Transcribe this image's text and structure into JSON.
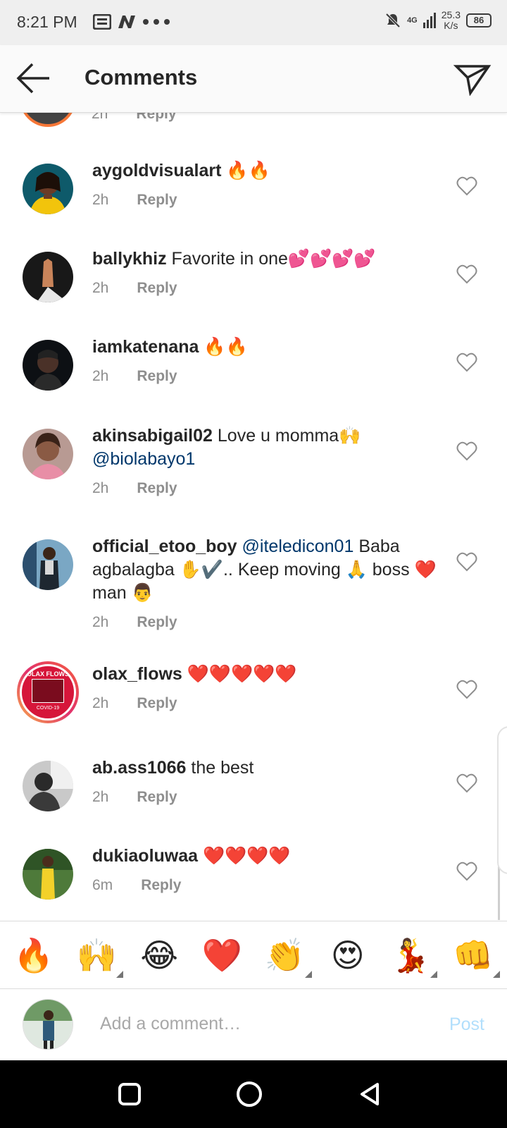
{
  "status_bar": {
    "time": "8:21 PM",
    "net_speed_value": "25.3",
    "net_speed_unit": "K/s",
    "battery": "86",
    "network": "4G"
  },
  "header": {
    "title": "Comments",
    "back_icon": "arrow-left-icon",
    "dm_icon": "paper-plane-icon"
  },
  "partial_comment": {
    "time": "2h",
    "reply": "Reply"
  },
  "comments": [
    {
      "username": "aygoldvisualart",
      "text": " 🔥🔥",
      "mention": "",
      "time": "2h",
      "reply": "Reply"
    },
    {
      "username": "ballykhiz",
      "text": " Favorite in one💕💕💕💕",
      "mention": "",
      "time": "2h",
      "reply": "Reply"
    },
    {
      "username": "iamkatenana",
      "text": " 🔥🔥",
      "mention": "",
      "time": "2h",
      "reply": "Reply"
    },
    {
      "username": "akinsabigail02",
      "text": " Love u momma🙌",
      "mention": "@biolabayo1",
      "time": "2h",
      "reply": "Reply"
    },
    {
      "username": "official_etoo_boy",
      "mention": "@iteledicon01",
      "text": " Baba agbalagba ✋✔️.. Keep moving 🙏 boss ❤️ man 👨",
      "time": "2h",
      "reply": "Reply"
    },
    {
      "username": "olax_flows",
      "text": " ❤️❤️❤️❤️❤️",
      "mention": "",
      "time": "2h",
      "reply": "Reply",
      "avatar_text": "OLAX FLOWS",
      "avatar_sub": "COVID-19"
    },
    {
      "username": "ab.ass1066",
      "text": " the best",
      "mention": "",
      "time": "2h",
      "reply": "Reply"
    },
    {
      "username": "dukiaoluwaa",
      "text": " ❤️❤️❤️❤️",
      "mention": "",
      "time": "6m",
      "reply": "Reply"
    }
  ],
  "emoji_bar": [
    "🔥",
    "🙌",
    "😂",
    "❤️",
    "👏",
    "😍",
    "💃",
    "👊"
  ],
  "composer": {
    "placeholder": "Add a comment…",
    "post_label": "Post"
  },
  "colors": {
    "accent_blue_disabled": "#b2dffc",
    "mention_blue": "#00376b",
    "secondary_text": "#8e8e8e",
    "story_ring": "#e1306c"
  }
}
